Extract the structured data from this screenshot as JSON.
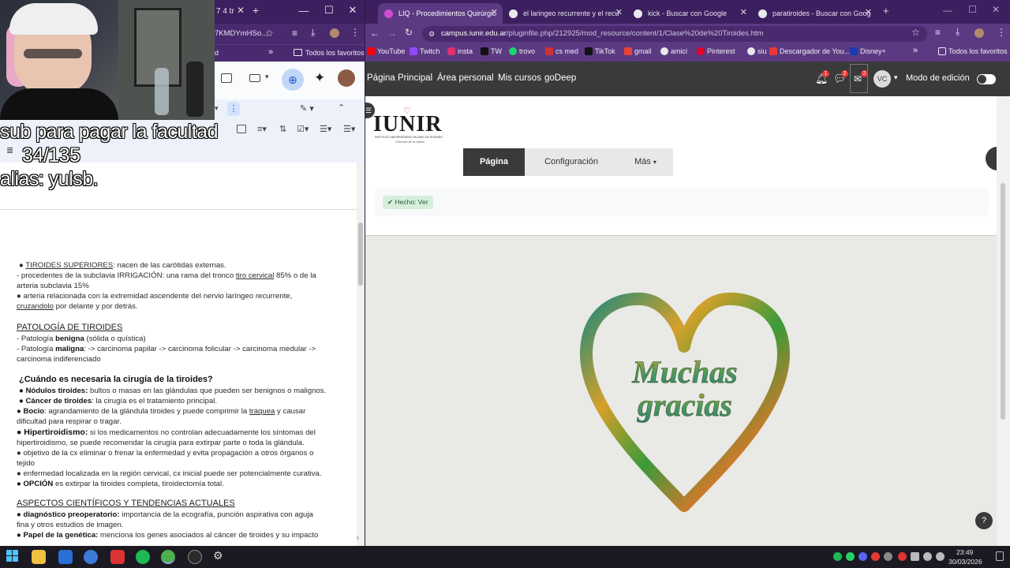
{
  "left_window": {
    "tab_fragment": "7 4 tr",
    "url_fragment": "7KMDYmHSo...",
    "bookmarks_fragment": "d",
    "bookmarks_folder": "Todos los favoritos",
    "webcam_overlay": {
      "line1": "sub para pagar la facultad",
      "line2": "34/135",
      "line3": "alias: yulsb."
    },
    "document": {
      "line_1_bullet": "●",
      "line_1_link": "TIROIDES SUPERIORES",
      "line_1_rest": ": nacen de las carótidas externas.",
      "line_2": "- procedentes de la subclavia IRRIGACIÓN: una rama del tronco ",
      "line_2_link": "tiro cervical",
      "line_2_rest": " 85% o de la",
      "line_3": "arteria subclavia 15%",
      "line_4": "● arteria relacionada con la extremidad ascendente del nervio laríngeo recurrente,",
      "line_5_link": "cruzandolo",
      "line_5_rest": " por delante y por detrás.",
      "heading_1": "PATOLOGÍA DE TIROIDES",
      "pat_1_pre": " - Patología ",
      "pat_1_bold": "benigna",
      "pat_1_rest": " (sólida o quística)",
      "pat_2_pre": "- Patología ",
      "pat_2_bold": "maligna",
      "pat_2_rest": ": -> carcinoma papilar -> carcinoma folicular -> carcinoma medular ->",
      "pat_3": "carcinoma indiferenciado",
      "question": "¿Cuándo es necesaria la cirugía de la tiroides?",
      "q1_bold": "● Nódulos tiroides:",
      "q1_rest": " bultos o masas en las glándulas que pueden ser benignos o malignos.",
      "q2_bold": "● Cáncer de tiroides",
      "q2_rest": ": la cirugía es el tratamiento principal.",
      "q3_bold": "● Bocio",
      "q3_rest": ": agrandamiento de la glándula tiroides y puede comprimir la ",
      "q3_link": "traquea",
      "q3_rest2": " y causar",
      "q3_cont": "dificultad para respirar o tragar.",
      "q4_bold": "● Hipertiroidismo:",
      "q4_rest": " si los medicamentos no controlan adecuadamente los síntomas del",
      "q4_cont": "hipertiroidismo, se puede recomendar la cirugía para extirpar parte o toda la glándula.",
      "q5": "● objetivo de la cx eliminar o frenar la enfermedad y evita propagación a otros órganos o",
      "q5_cont": "tejido",
      "q6": "● enfermedad localizada en la región cervical, cx inicial puede ser potencialmente curativa.",
      "q7_bold": "● OPCIÓN",
      "q7_rest": " es extirpar la tiroides completa, tiroidectomía total.",
      "heading_2": "ASPECTOS CIENTÍFICOS Y TENDENCIAS ACTUALES",
      "a1_bold": "● diagnóstico preoperatorio:",
      "a1_rest": " importancia de la ecografía, punción aspirativa con aguja",
      "a1_cont": "fina y otros estudios de imagen.",
      "a2_bold": "● Papel de la genética:",
      "a2_rest": " menciona los genes asociados al cáncer de tiroides y su impacto"
    }
  },
  "right_window": {
    "tabs": [
      {
        "label": "LIQ - Procedimientos Quirúrgic",
        "active": true
      },
      {
        "label": "el laringeo recurrente y el recu",
        "active": false
      },
      {
        "label": "kick - Buscar con Google",
        "active": false
      },
      {
        "label": "paratiroides - Buscar con Goog",
        "active": false
      }
    ],
    "url_host": "campus.iunir.edu.ar",
    "url_path": "/pluginfile.php/212925/mod_resource/content/1/Clase%20de%20Tiroides.htm",
    "bookmarks": [
      "YouTube",
      "Twitch",
      "insta",
      "TW",
      "trovo",
      "cs med",
      "TikTok",
      "gmail",
      "amici",
      "Pinterest",
      "siu",
      "Descargador de You...",
      "Disney+"
    ],
    "bookmarks_folder": "Todos los favoritos",
    "moodle_nav": [
      "Página Principal",
      "Área personal",
      "Mis cursos",
      "goDeep"
    ],
    "notif_badges": [
      "1",
      "2",
      "2"
    ],
    "user_initials": "VC",
    "edit_mode_label": "Modo de edición",
    "logo_text": "IUNIR",
    "logo_subtitle": "INSTITUTO UNIVERSITARIO ITALIANO DE ROSARIO",
    "logo_tagline": "Ciencias de la Salud",
    "secondary_nav": [
      "Página",
      "Configuración",
      "Más"
    ],
    "done_badge": "✔ Hecho: Ver",
    "image_text_1": "Muchas",
    "image_text_2": "gracias",
    "help_label": "?"
  },
  "taskbar": {
    "time": "23:49",
    "date": "30/03/2026"
  }
}
